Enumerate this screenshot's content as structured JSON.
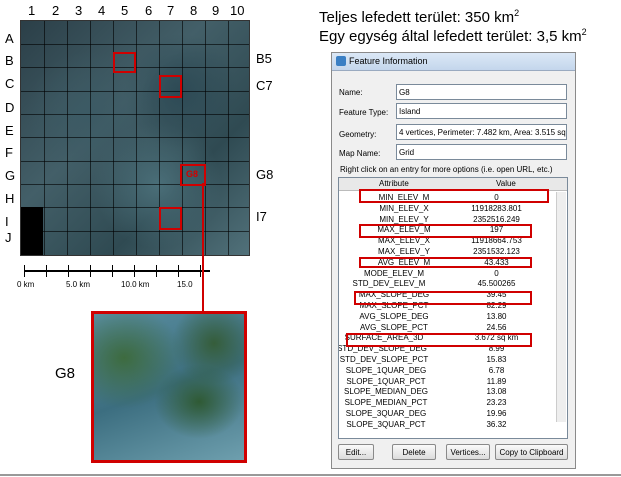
{
  "grid": {
    "columns": [
      "1",
      "2",
      "3",
      "4",
      "5",
      "6",
      "7",
      "8",
      "9",
      "10"
    ],
    "rows": [
      "A",
      "B",
      "C",
      "D",
      "E",
      "F",
      "G",
      "H",
      "I",
      "J"
    ],
    "g8_label": "G8"
  },
  "callouts": {
    "b5": "B5",
    "c7": "C7",
    "g8": "G8",
    "i7": "I7",
    "inset_label": "G8"
  },
  "scale": {
    "labels": [
      "0 km",
      "5.0 km",
      "10.0 km",
      "15.0"
    ]
  },
  "info": {
    "line1_prefix": "Teljes lefedett terület: 350 km",
    "line1_sup": "2",
    "line2_prefix": "Egy egység által lefedett terület: 3,5 km",
    "line2_sup": "2"
  },
  "dialog": {
    "title": "Feature Information",
    "name_label": "Name:",
    "name_value": "G8",
    "type_label": "Feature Type:",
    "type_value": "Island",
    "geometry_label": "Geometry:",
    "geometry_value": "4 vertices, Perimeter: 7.482 km, Area: 3.515 sq",
    "mapname_label": "Map Name:",
    "mapname_value": "Grid",
    "hint": "Right click on an entry for more options (i.e. open URL, etc.)",
    "col_attribute": "Attribute",
    "col_value": "Value",
    "rows": [
      {
        "attr": "MIN_ELEV_M",
        "val": "0"
      },
      {
        "attr": "MIN_ELEV_X",
        "val": "11918283.801"
      },
      {
        "attr": "MIN_ELEV_Y",
        "val": "2352516.249"
      },
      {
        "attr": "MAX_ELEV_M",
        "val": "197"
      },
      {
        "attr": "MAX_ELEV_X",
        "val": "11918664.753"
      },
      {
        "attr": "MAX_ELEV_Y",
        "val": "2351532.123"
      },
      {
        "attr": "AVG_ELEV_M",
        "val": "43.433"
      },
      {
        "attr": "MODE_ELEV_M",
        "val": "0"
      },
      {
        "attr": "STD_DEV_ELEV_M",
        "val": "45.500265"
      },
      {
        "attr": "MAX_SLOPE_DEG",
        "val": "39.45"
      },
      {
        "attr": "MAX_SLOPE_PCT",
        "val": "82.29"
      },
      {
        "attr": "AVG_SLOPE_DEG",
        "val": "13.80"
      },
      {
        "attr": "AVG_SLOPE_PCT",
        "val": "24.56"
      },
      {
        "attr": "SURFACE_AREA_3D",
        "val": "3.672 sq km"
      },
      {
        "attr": "STD_DEV_SLOPE_DEG",
        "val": "8.99"
      },
      {
        "attr": "STD_DEV_SLOPE_PCT",
        "val": "15.83"
      },
      {
        "attr": "SLOPE_1QUAR_DEG",
        "val": "6.78"
      },
      {
        "attr": "SLOPE_1QUAR_PCT",
        "val": "11.89"
      },
      {
        "attr": "SLOPE_MEDIAN_DEG",
        "val": "13.08"
      },
      {
        "attr": "SLOPE_MEDIAN_PCT",
        "val": "23.23"
      },
      {
        "attr": "SLOPE_3QUAR_DEG",
        "val": "19.96"
      },
      {
        "attr": "SLOPE_3QUAR_PCT",
        "val": "36.32"
      }
    ],
    "buttons": {
      "edit": "Edit...",
      "delete": "Delete",
      "vertices": "Vertices...",
      "copy": "Copy to Clipboard"
    }
  },
  "colors": {
    "highlight": "#d00000"
  }
}
